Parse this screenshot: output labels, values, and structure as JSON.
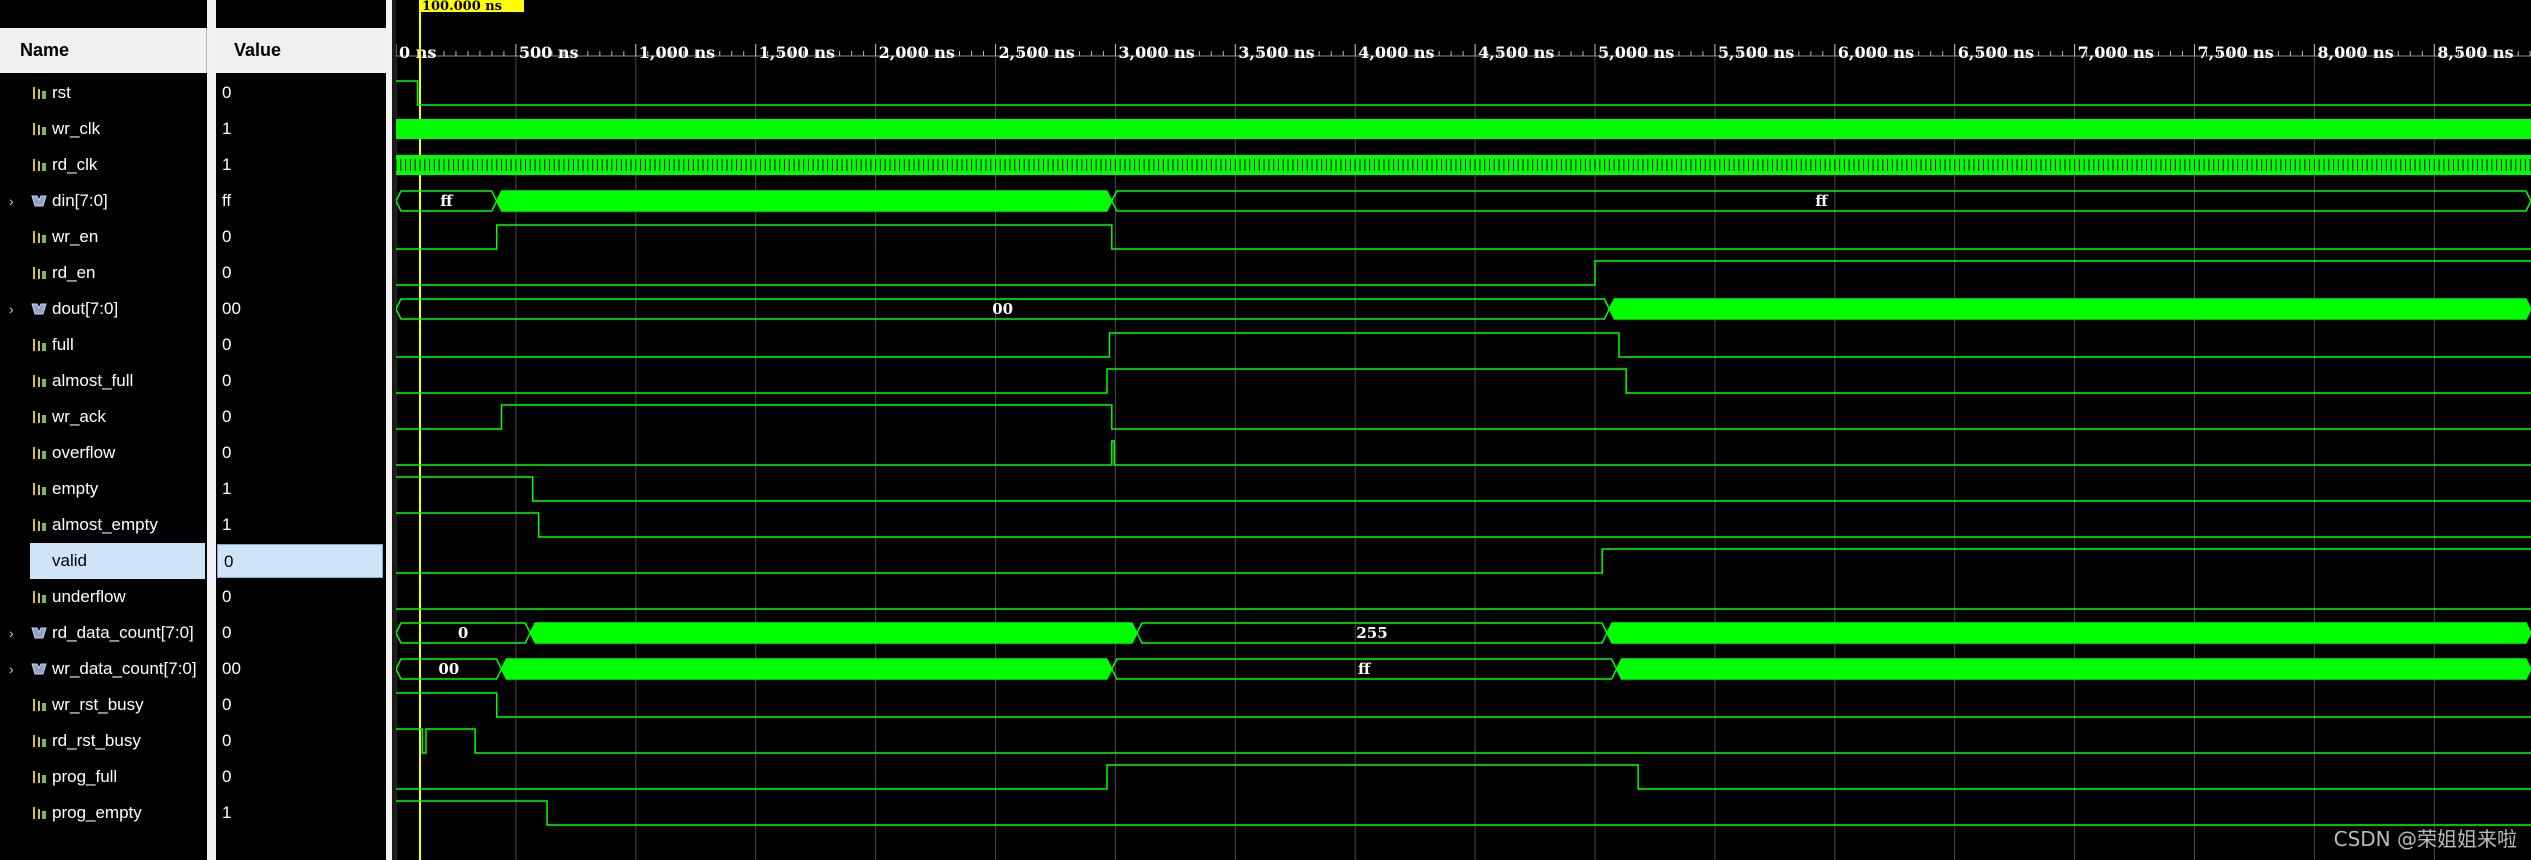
{
  "header": {
    "name_label": "Name",
    "value_label": "Value"
  },
  "cursor_label": "100.000 ns",
  "timeline": {
    "ticks": [
      "0 ns",
      "500 ns",
      "1,000 ns",
      "1,500 ns",
      "2,000 ns",
      "2,500 ns",
      "3,000 ns",
      "3,500 ns",
      "4,000 ns",
      "4,500 ns",
      "5,000 ns",
      "5,500 ns",
      "6,000 ns",
      "6,500 ns",
      "7,000 ns",
      "7,500 ns",
      "8,000 ns",
      "8,500 ns"
    ]
  },
  "signals": [
    {
      "name": "rst",
      "value": "0",
      "kind": "bit"
    },
    {
      "name": "wr_clk",
      "value": "1",
      "kind": "bit"
    },
    {
      "name": "rd_clk",
      "value": "1",
      "kind": "bit"
    },
    {
      "name": "din[7:0]",
      "value": "ff",
      "kind": "bus"
    },
    {
      "name": "wr_en",
      "value": "0",
      "kind": "bit"
    },
    {
      "name": "rd_en",
      "value": "0",
      "kind": "bit"
    },
    {
      "name": "dout[7:0]",
      "value": "00",
      "kind": "bus"
    },
    {
      "name": "full",
      "value": "0",
      "kind": "bit"
    },
    {
      "name": "almost_full",
      "value": "0",
      "kind": "bit"
    },
    {
      "name": "wr_ack",
      "value": "0",
      "kind": "bit"
    },
    {
      "name": "overflow",
      "value": "0",
      "kind": "bit"
    },
    {
      "name": "empty",
      "value": "1",
      "kind": "bit"
    },
    {
      "name": "almost_empty",
      "value": "1",
      "kind": "bit"
    },
    {
      "name": "valid",
      "value": "0",
      "kind": "bit",
      "selected": true
    },
    {
      "name": "underflow",
      "value": "0",
      "kind": "bit"
    },
    {
      "name": "rd_data_count[7:0]",
      "value": "0",
      "kind": "bus"
    },
    {
      "name": "wr_data_count[7:0]",
      "value": "00",
      "kind": "bus"
    },
    {
      "name": "wr_rst_busy",
      "value": "0",
      "kind": "bit"
    },
    {
      "name": "rd_rst_busy",
      "value": "0",
      "kind": "bit"
    },
    {
      "name": "prog_full",
      "value": "0",
      "kind": "bit"
    },
    {
      "name": "prog_empty",
      "value": "1",
      "kind": "bit"
    }
  ],
  "bus_labels": {
    "din_first": "ff",
    "din_last": "ff",
    "dout_first": "00",
    "rd_count_first": "0",
    "rd_count_mid": "255",
    "wr_count_first": "00",
    "wr_count_mid": "ff"
  },
  "watermark": "CSDN @荣姐姐来啦",
  "colors": {
    "wave": "#00ff00",
    "grid": "#4a4a4a",
    "cursor": "#ffff00",
    "bus_fill": "#00ff00"
  }
}
